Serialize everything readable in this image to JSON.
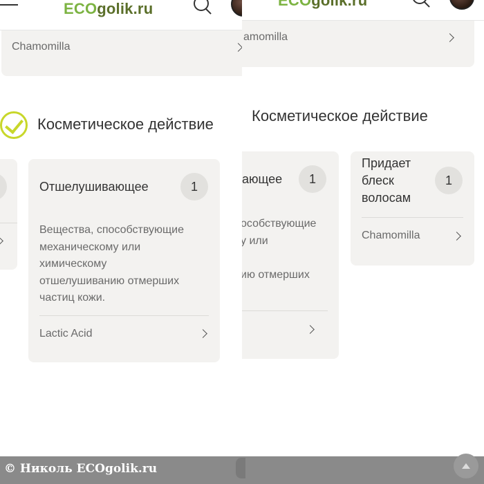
{
  "site": {
    "logo_eco": "ECO",
    "logo_golik": "golik.ru"
  },
  "left": {
    "prev_card_ingredient": "Chamomilla",
    "section_title": "Косметическое действие",
    "card": {
      "title": "Отшелушивающее",
      "count": "1",
      "description_lines": [
        "Вещества, способствующие",
        "механическому или",
        "химическому",
        "отшелушиванию отмерших",
        "частиц кожи."
      ],
      "ingredient": "Lactic Acid"
    }
  },
  "right": {
    "prev_card_ingredient": "amomilla",
    "section_title": "Косметическое действие",
    "card_partial": {
      "title": "ающее",
      "count": "1",
      "description_lines": [
        "особствующие",
        "у или",
        "",
        "ию отмерших"
      ]
    },
    "card": {
      "title_lines": [
        "Придает",
        "блеск",
        "волосам"
      ],
      "count": "1",
      "ingredient": "Chamomilla"
    }
  },
  "footer": {
    "credit": "© Николь ECOgolik.ru"
  },
  "colors": {
    "accent_green": "#7cb342",
    "check_yellow_green": "#c8d72a",
    "card_bg": "#f3f2f0",
    "bottom_bar": "#8a8a8a"
  }
}
